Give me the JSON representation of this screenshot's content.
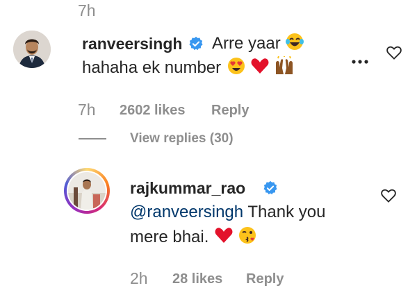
{
  "top_time": "7h",
  "comment": {
    "username": "ranveersingh",
    "text_line1": "Arre yaar",
    "text_line2": "hahaha ek number",
    "time": "7h",
    "likes": "2602 likes",
    "reply_label": "Reply",
    "view_replies": "View replies (30)",
    "more_label": "..."
  },
  "reply": {
    "username": "rajkummar_rao",
    "mention": "@ranveersingh",
    "text_line1": " Thank you",
    "text_line2": "mere bhai.",
    "time": "2h",
    "likes": "28 likes",
    "reply_label": "Reply"
  },
  "icons": {
    "verified": "verified-badge-icon",
    "heart": "heart-outline-icon",
    "more": "more-options-icon"
  },
  "colors": {
    "verified_blue": "#3897f0",
    "heart_red": "#ed4956",
    "muted": "#8e8e8e",
    "mention": "#00376b"
  }
}
